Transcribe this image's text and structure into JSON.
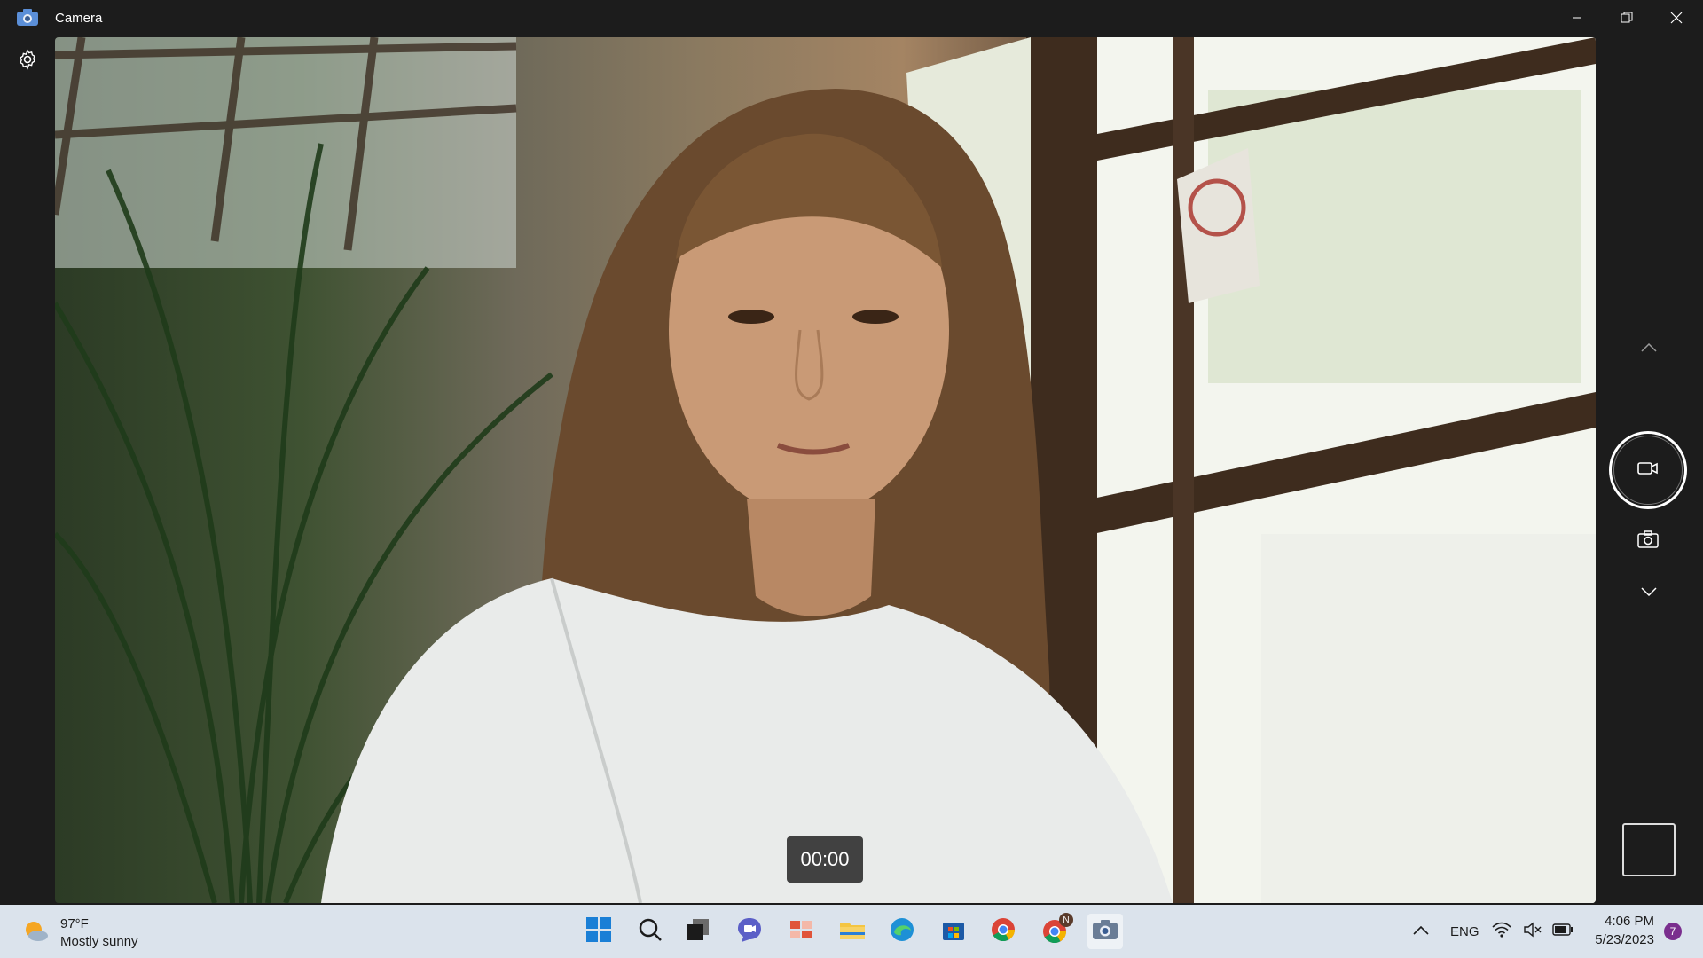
{
  "window": {
    "title": "Camera"
  },
  "viewfinder": {
    "timer": "00:00"
  },
  "taskbar": {
    "weather": {
      "temperature": "97°F",
      "condition": "Mostly sunny"
    },
    "language": "ENG",
    "time": "4:06 PM",
    "date": "5/23/2023",
    "notification_count": "7",
    "chrome_profile_badge": "N",
    "pinned_apps": [
      "start",
      "search",
      "task-view",
      "chat",
      "widgets",
      "file-explorer",
      "edge",
      "microsoft-store",
      "chrome",
      "chrome-profile",
      "camera"
    ]
  },
  "colors": {
    "titlebar": "#1c1c1c",
    "taskbar": "#dbe3ec",
    "accent": "#7a2e8e"
  }
}
